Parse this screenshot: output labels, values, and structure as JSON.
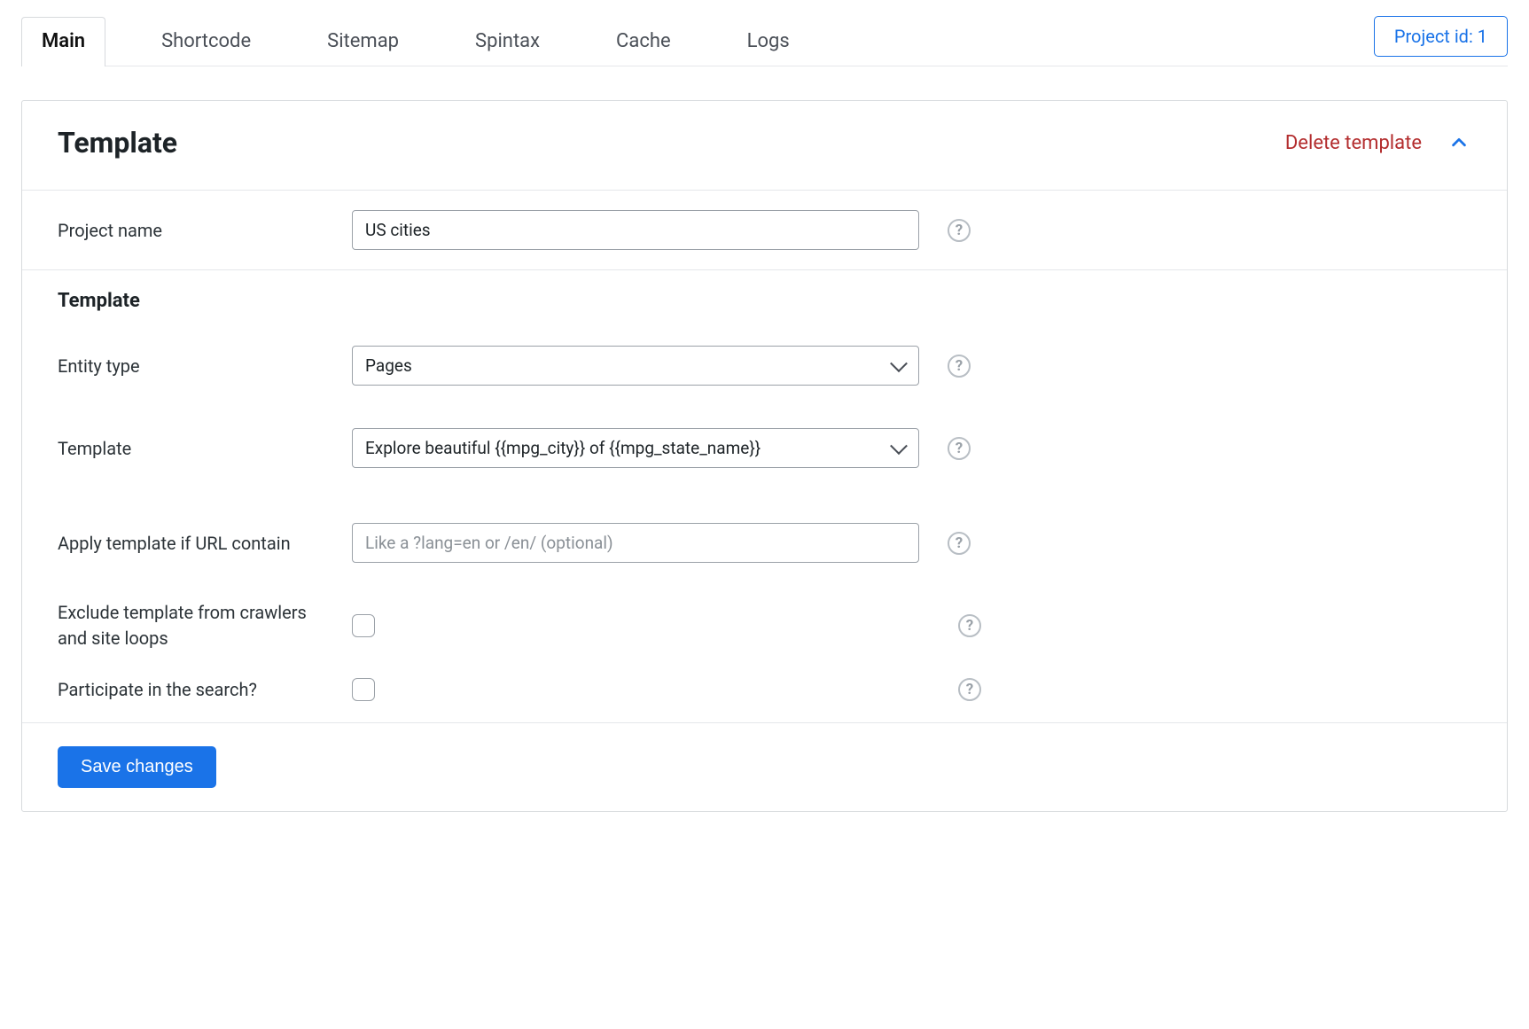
{
  "tabs": {
    "main": "Main",
    "shortcode": "Shortcode",
    "sitemap": "Sitemap",
    "spintax": "Spintax",
    "cache": "Cache",
    "logs": "Logs"
  },
  "project_id_label": "Project id: 1",
  "panel": {
    "title": "Template",
    "delete": "Delete template"
  },
  "labels": {
    "project_name": "Project name",
    "section_template": "Template",
    "entity_type": "Entity type",
    "template": "Template",
    "apply_url": "Apply template if URL contain",
    "exclude": "Exclude template from crawlers and site loops",
    "participate": "Participate in the search?"
  },
  "values": {
    "project_name": "US cities",
    "entity_type": "Pages",
    "template": "Explore beautiful {{mpg_city}} of {{mpg_state_name}}",
    "apply_url": ""
  },
  "placeholders": {
    "apply_url": "Like a ?lang=en or /en/ (optional)"
  },
  "buttons": {
    "save": "Save changes"
  },
  "help_glyph": "?"
}
